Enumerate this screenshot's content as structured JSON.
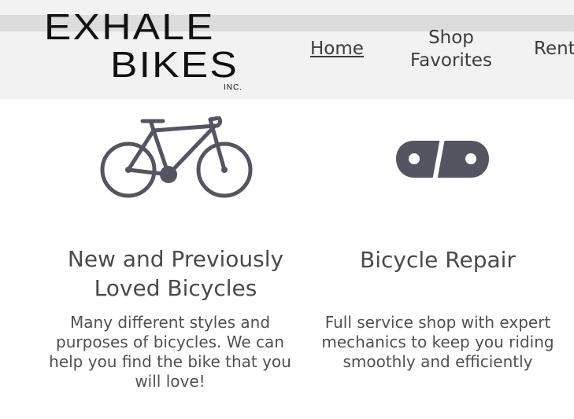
{
  "brand": {
    "logo_line1": "EXHALE",
    "logo_line2": "BIKES",
    "logo_inc": "INC."
  },
  "nav": {
    "home": "Home",
    "shop_favorites": "Shop Favorites",
    "rent": "Rent"
  },
  "cards": [
    {
      "icon": "bicycle-icon",
      "title": "New and Previously Loved Bicycles",
      "text": "Many different styles and purposes of bicycles. We can help you find the bike that you will love!"
    },
    {
      "icon": "bike-chain-link-icon",
      "title": "Bicycle Repair",
      "text": "Full service shop with expert mechanics to keep you riding smoothly and efficiently"
    }
  ],
  "colors": {
    "header_bg": "#f2f2f2",
    "header_stripe": "#dcdcdc",
    "icon": "#545560",
    "text": "#4a4a4a"
  }
}
